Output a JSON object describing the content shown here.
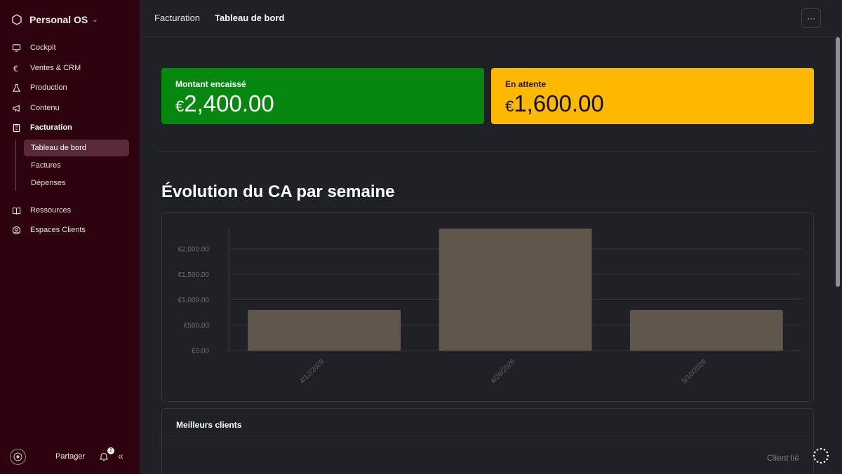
{
  "sidebar": {
    "workspace": "Personal OS",
    "items": [
      {
        "label": "Cockpit",
        "icon": "monitor-icon"
      },
      {
        "label": "Ventes & CRM",
        "icon": "euro-icon"
      },
      {
        "label": "Production",
        "icon": "flask-icon"
      },
      {
        "label": "Contenu",
        "icon": "megaphone-icon"
      },
      {
        "label": "Facturation",
        "icon": "calculator-icon"
      },
      {
        "label": "Ressources",
        "icon": "book-icon"
      },
      {
        "label": "Espaces Clients",
        "icon": "user-circle-icon"
      }
    ],
    "subitems": [
      "Tableau de bord",
      "Factures",
      "Dépenses"
    ],
    "footer": {
      "share_label": "Partager",
      "notif_count": "2"
    }
  },
  "header": {
    "breadcrumb_parent": "Facturation",
    "breadcrumb_current": "Tableau de bord",
    "more_label": "···"
  },
  "cards": {
    "collected": {
      "label": "Montant encaissé",
      "currency": "€",
      "amount": "2,400.00",
      "color": "#06880f"
    },
    "pending": {
      "label": "En attente",
      "currency": "€",
      "amount": "1,600.00",
      "color": "#ffb800"
    }
  },
  "section_title": "Évolution du CA par semaine",
  "chart_data": {
    "type": "bar",
    "categories": [
      "4/12/2026",
      "4/26/2026",
      "5/10/2026"
    ],
    "values": [
      800,
      2400,
      800
    ],
    "ylim": [
      0,
      2400
    ],
    "yticks": [
      0,
      500,
      1000,
      1500,
      2000
    ],
    "ytick_labels": [
      "€0.00",
      "€500.00",
      "€1,000.00",
      "€1,500.00",
      "€2,000.00"
    ],
    "bar_color": "#5f574b",
    "grid": true
  },
  "clients": {
    "title": "Meilleurs clients",
    "column_header": "Client lié"
  }
}
